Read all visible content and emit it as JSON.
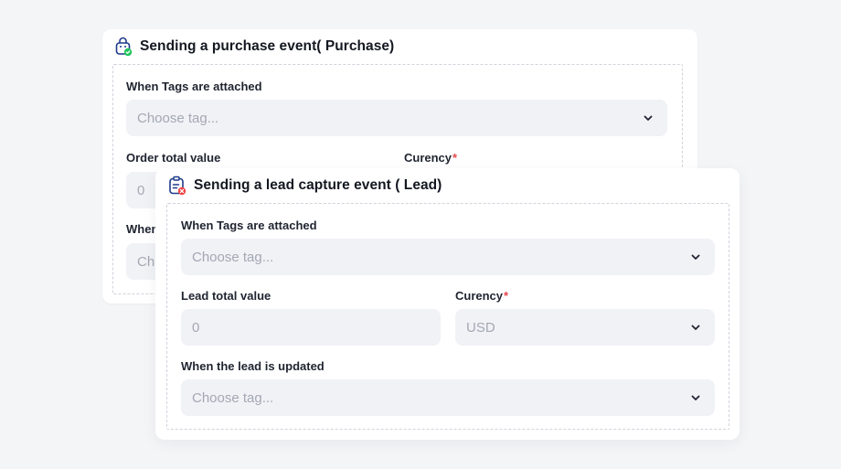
{
  "purchase": {
    "title": "Sending a purchase event( Purchase)",
    "tags_label": "When Tags are attached",
    "tags_placeholder": "Choose tag...",
    "order_label": "Order total value",
    "order_value": "0",
    "currency_label": "Curency",
    "required_mark": "*",
    "when_label_partial": "When",
    "choose_partial": "Ch",
    "icon": "shopping-bag-check-icon"
  },
  "lead": {
    "title": "Sending a lead capture event ( Lead)",
    "tags_label": "When Tags are attached",
    "tags_placeholder": "Choose tag...",
    "lead_value_label": "Lead total value",
    "lead_value": "0",
    "currency_label": "Curency",
    "required_mark": "*",
    "currency_value": "USD",
    "updated_label": "When the lead is updated",
    "updated_placeholder": "Choose tag...",
    "icon": "clipboard-error-icon"
  },
  "colors": {
    "accent_green": "#22c55e",
    "accent_red": "#ef4444",
    "icon_navy": "#1e3a8a"
  }
}
